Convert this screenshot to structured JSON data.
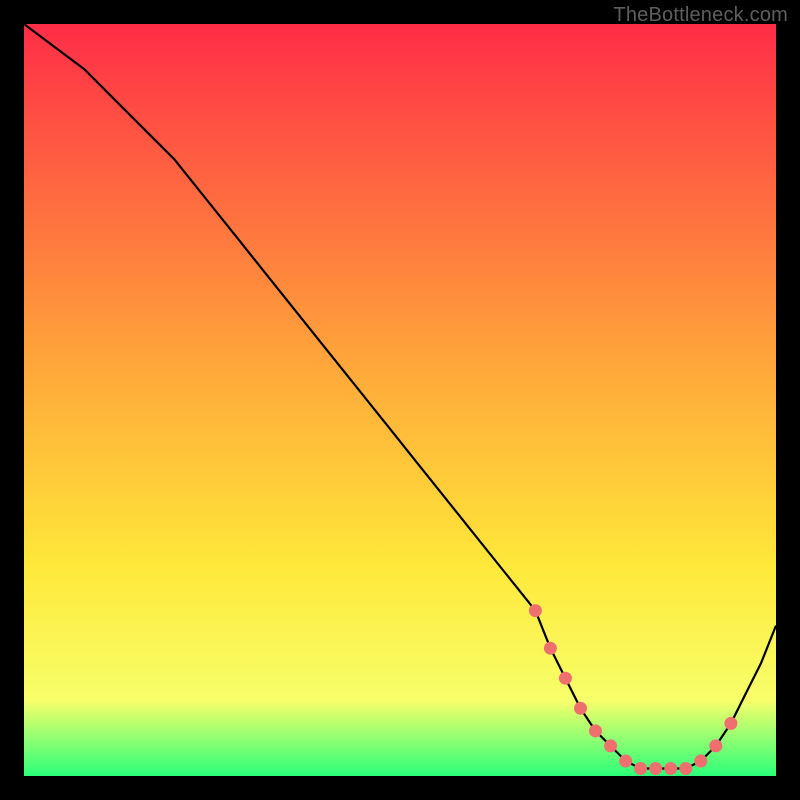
{
  "watermark": "TheBottleneck.com",
  "colors": {
    "top": "#ff2d47",
    "mid1": "#ffa63a",
    "mid2": "#ffe83a",
    "mid3": "#f7ff6a",
    "bottom": "#2bff7a",
    "line": "#000000",
    "dot_fill": "#ef6f6f",
    "dot_stroke": "#ef6f6f",
    "frame": "#000000"
  },
  "chart_data": {
    "type": "line",
    "title": "",
    "xlabel": "",
    "ylabel": "",
    "xlim": [
      0,
      100
    ],
    "ylim": [
      0,
      100
    ],
    "x": [
      0,
      4,
      8,
      12,
      16,
      20,
      24,
      28,
      32,
      36,
      40,
      44,
      48,
      52,
      56,
      60,
      64,
      68,
      70,
      72,
      74,
      76,
      78,
      80,
      82,
      84,
      86,
      88,
      90,
      92,
      94,
      96,
      98,
      100
    ],
    "values": [
      100,
      97,
      94,
      90,
      86,
      82,
      77,
      72,
      67,
      62,
      57,
      52,
      47,
      42,
      37,
      32,
      27,
      22,
      17,
      13,
      9,
      6,
      4,
      2,
      1,
      1,
      1,
      1,
      2,
      4,
      7,
      11,
      15,
      20
    ],
    "markers": {
      "x": [
        68,
        70,
        72,
        74,
        76,
        78,
        80,
        82,
        84,
        86,
        88,
        90,
        92,
        94
      ],
      "values": [
        22,
        17,
        13,
        9,
        6,
        4,
        2,
        1,
        1,
        1,
        1,
        2,
        4,
        7
      ]
    }
  }
}
